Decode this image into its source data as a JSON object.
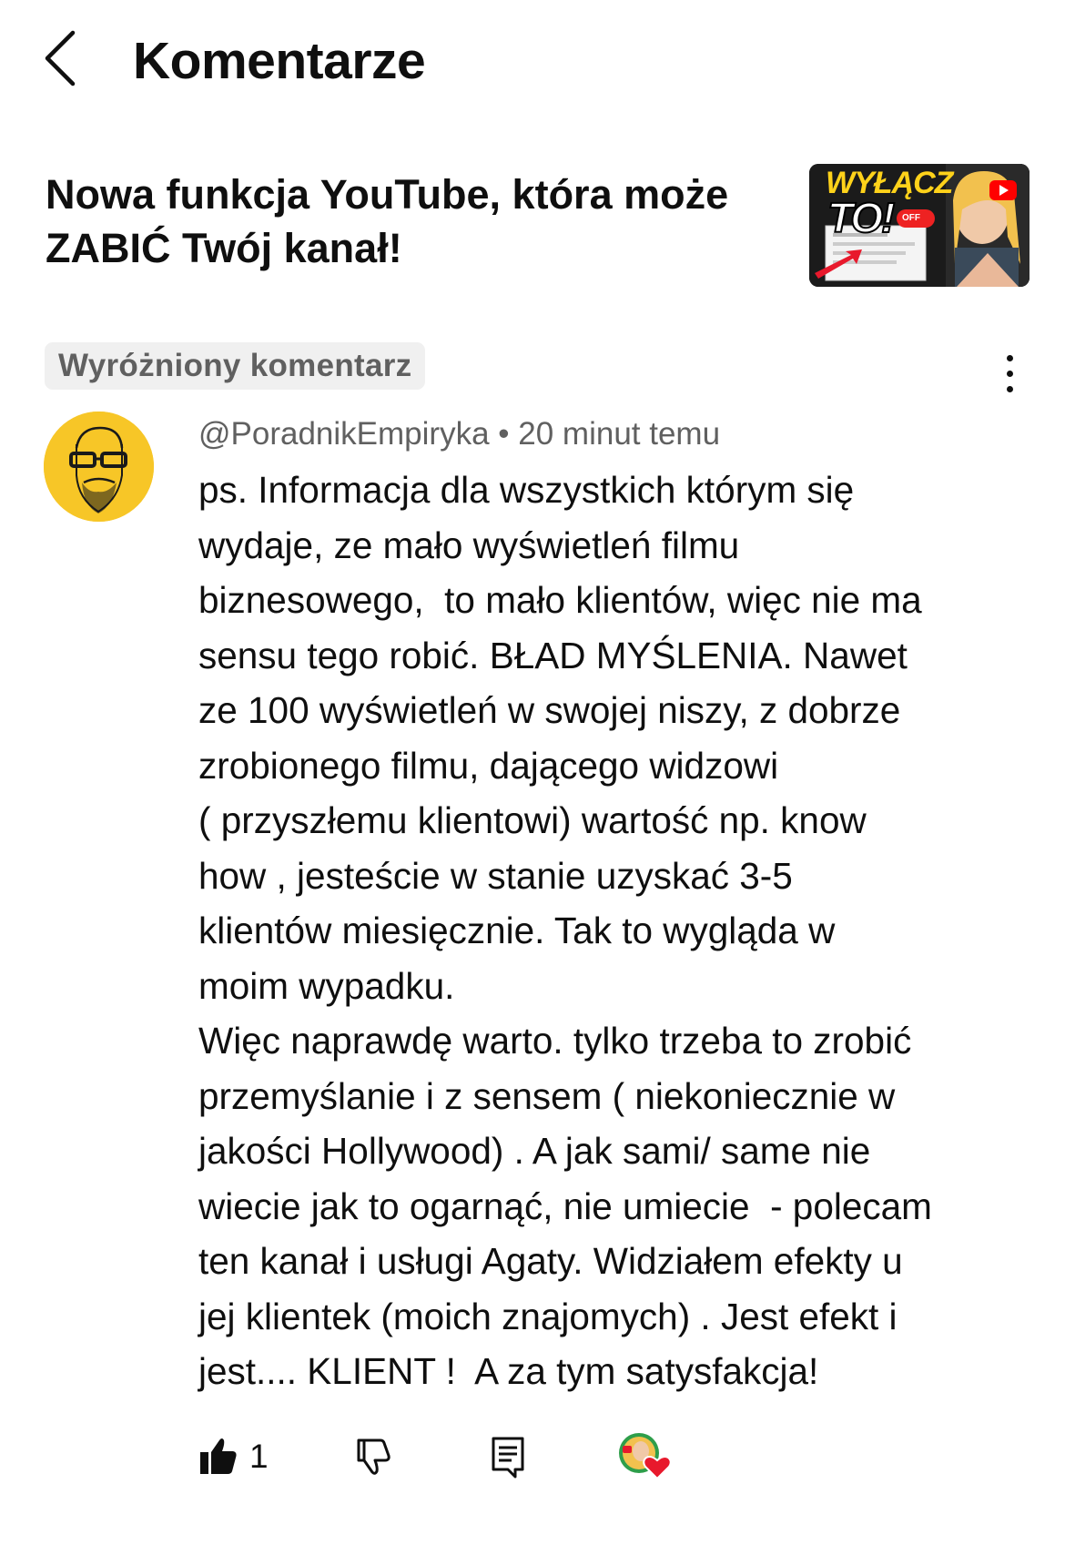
{
  "header": {
    "title": "Komentarze",
    "back_icon": "chevron-left-icon"
  },
  "video": {
    "title": "Nowa funkcja YouTube, która może ZABIĆ Twój kanał!",
    "thumbnail": {
      "line1": "WYŁĄCZ",
      "line2": "TO!",
      "toggle": "OFF"
    }
  },
  "comment": {
    "pinned_label": "Wyróżniony komentarz",
    "author": "@PoradnikEmpiryka",
    "separator": "•",
    "time": "20 minut temu",
    "text": "ps. Informacja dla wszystkich którym się\nwydaje, ze mało wyświetleń filmu\nbiznesowego,  to mało klientów, więc nie ma\nsensu tego robić. BŁAD MYŚLENIA. Nawet\nze 100 wyświetleń w swojej niszy, z dobrze\nzrobionego filmu, dającego widzowi\n( przyszłemu klientowi) wartość np. know\nhow , jesteście w stanie uzyskać 3-5\nklientów miesięcznie. Tak to wygląda w\nmoim wypadku.\nWięc naprawdę warto. tylko trzeba to zrobić\nprzemyślanie i z sensem ( niekoniecznie w\njakości Hollywood) . A jak sami/ same nie\nwiecie jak to ogarnąć, nie umiecie  - polecam\nten kanał i usługi Agaty. Widziałem efekty u\njej klientek (moich znajomych) . Jest efekt i\njest.... KLIENT !  A za tym satysfakcja!",
    "likes": "1"
  },
  "colors": {
    "text": "#0f0f0f",
    "secondary": "#606060",
    "badge_bg": "#f0f0f0",
    "avatar_bg": "#f7c627",
    "heart": "#e8192c"
  }
}
